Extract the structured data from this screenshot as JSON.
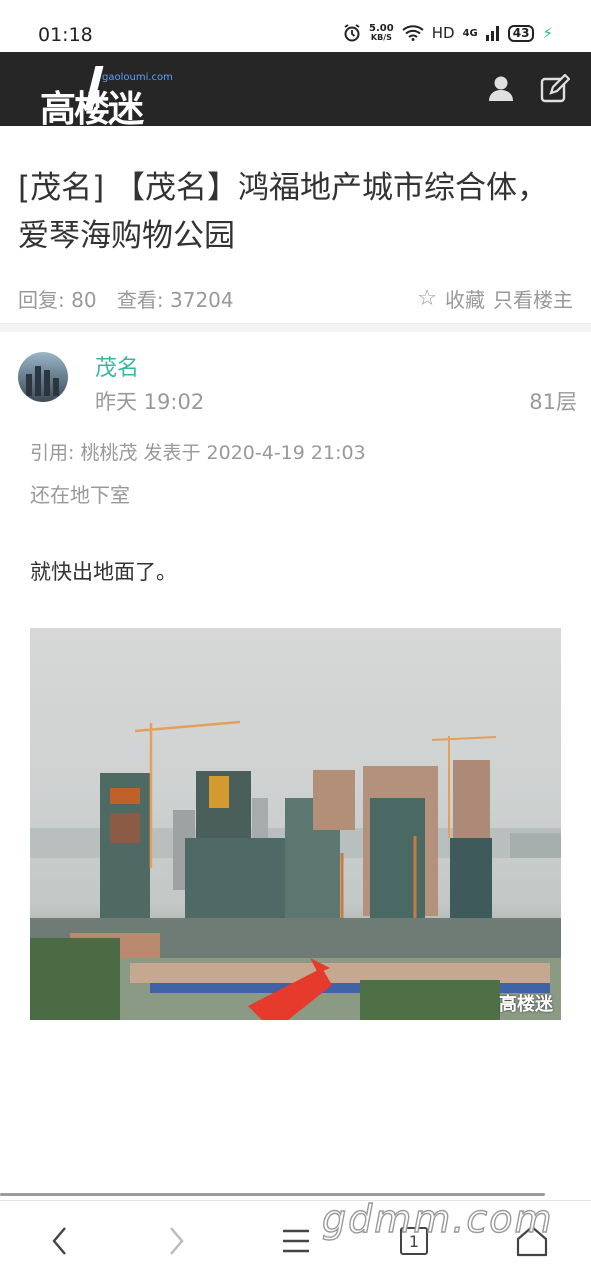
{
  "status_bar": {
    "time": "01:18",
    "net_speed": "5.00",
    "net_unit": "KB/S",
    "hd": "HD",
    "signal": "4G",
    "battery": "43"
  },
  "header": {
    "logo_text": "高楼迷",
    "logo_url": "gaoloumi.com",
    "icons": [
      "user-icon",
      "edit-icon"
    ]
  },
  "thread": {
    "title": "[茂名] 【茂名】鸿福地产城市综合体，爱琴海购物公园",
    "replies": "回复: 80",
    "views": "查看: 37204",
    "favorite_label": "收藏",
    "only_author_label": "只看楼主"
  },
  "post": {
    "author": "茂名",
    "time": "昨天 19:02",
    "floor": "81层",
    "quote_header": "引用: 桃桃茂 发表于 2020-4-19 21:03",
    "quote_body": "还在地下室",
    "content": "就快出地面了。",
    "image_watermark": "高楼迷"
  },
  "bottom_nav": {
    "tab_count": "1",
    "icons": [
      "back-icon",
      "forward-icon",
      "menu-icon",
      "tabs-icon",
      "home-icon"
    ]
  },
  "watermark": "gdmm.com",
  "colors": {
    "header_bg": "#262626",
    "author": "#37b7a2",
    "muted": "#999999"
  }
}
